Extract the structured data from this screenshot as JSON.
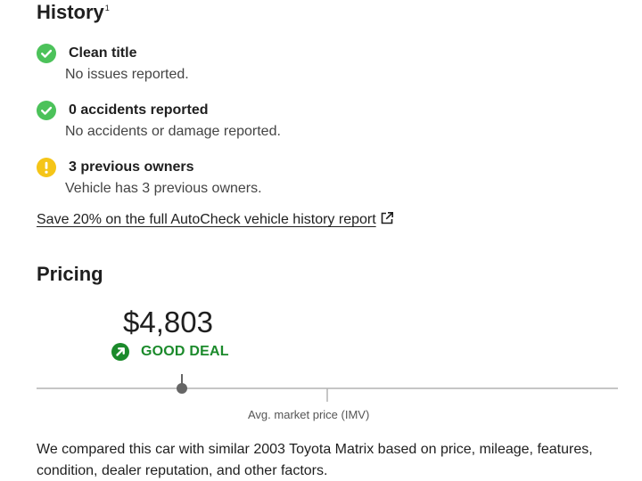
{
  "history": {
    "title": "History",
    "footnote_marker": "1",
    "items": [
      {
        "title": "Clean title",
        "description": "No issues reported.",
        "status": "ok",
        "icon": "check-circle-icon"
      },
      {
        "title": "0 accidents reported",
        "description": "No accidents or damage reported.",
        "status": "ok",
        "icon": "check-circle-icon"
      },
      {
        "title": "3 previous owners",
        "description": "Vehicle has 3 previous owners.",
        "status": "warning",
        "icon": "exclamation-circle-icon"
      }
    ],
    "report_link": "Save 20% on the full AutoCheck vehicle history report",
    "report_link_icon": "external-link-icon"
  },
  "pricing": {
    "title": "Pricing",
    "price": "$4,803",
    "deal_label": "GOOD DEAL",
    "deal_icon": "arrow-up-right-circle-icon",
    "imv_label": "Avg. market price (IMV)",
    "description": "We compared this car with similar 2003 Toyota Matrix based on price, mileage, features, condition, dealer reputation, and other factors."
  },
  "colors": {
    "ok": "#4cc25a",
    "warning": "#f5c518",
    "good_deal": "#1b8a2b",
    "scale_line": "#b3b3b3",
    "marker": "#666666"
  }
}
